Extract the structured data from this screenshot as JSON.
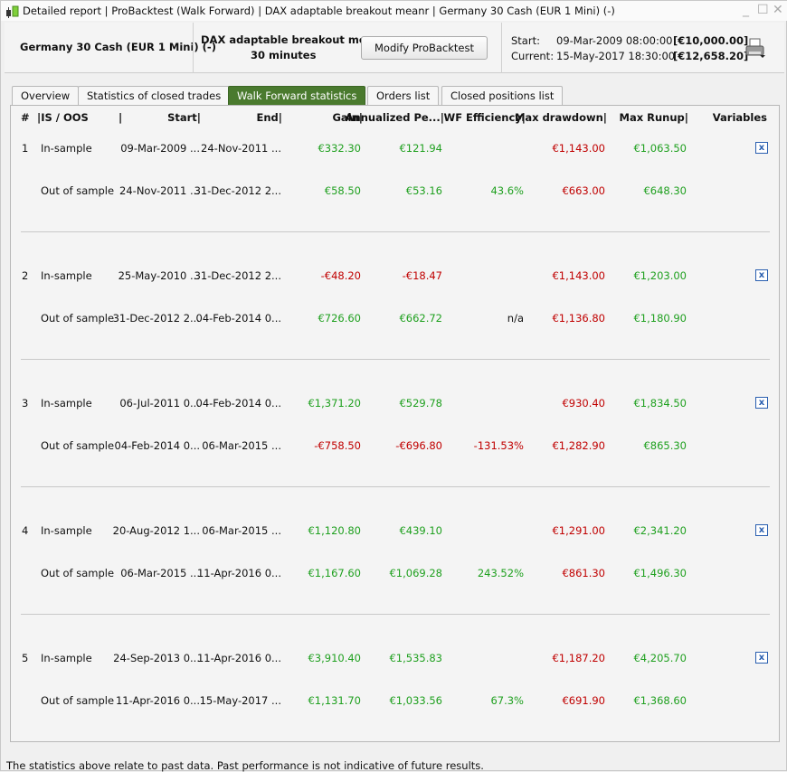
{
  "title": {
    "parts": "Detailed report | ProBacktest (Walk Forward) | DAX adaptable breakout meanr | Germany 30 Cash (EUR 1 Mini) (-)"
  },
  "header": {
    "instrument": "Germany 30 Cash (EUR 1 Mini) (-)",
    "strategy": "DAX adaptable breakout meanr",
    "timeframe": "30 minutes",
    "modify_label": "Modify ProBacktest",
    "start_label": "Start:",
    "start_value": "09-Mar-2009 08:00:00",
    "start_capital": "[€10,000.00]",
    "current_label": "Current:",
    "current_value": "15-May-2017 18:30:00",
    "current_capital": "[€12,658.20]"
  },
  "tabs": [
    "Overview",
    "Statistics of closed trades",
    "Walk Forward statistics",
    "Orders list",
    "Closed positions list"
  ],
  "columns": [
    "#",
    "|IS / OOS",
    "|",
    "Start|",
    "End|",
    "Gain|",
    "Annualized Pe...|",
    "WF Efficiency|",
    "Max drawdown|",
    "Max Runup|",
    "Variables"
  ],
  "groups": [
    {
      "n": "1",
      "rows": [
        {
          "type": "In-sample",
          "start": "09-Mar-2009 ...",
          "end": "24-Nov-2011 ...",
          "gain": "€332.30",
          "ann": "€121.94",
          "wf": "",
          "dd": "€1,143.00",
          "runup": "€1,063.50"
        },
        {
          "type": "Out of sample",
          "start": "24-Nov-2011 ...",
          "end": "31-Dec-2012 2...",
          "gain": "€58.50",
          "ann": "€53.16",
          "wf": "43.6%",
          "dd": "€663.00",
          "runup": "€648.30"
        }
      ]
    },
    {
      "n": "2",
      "rows": [
        {
          "type": "In-sample",
          "start": "25-May-2010 ...",
          "end": "31-Dec-2012 2...",
          "gain": "-€48.20",
          "ann": "-€18.47",
          "wf": "",
          "dd": "€1,143.00",
          "runup": "€1,203.00"
        },
        {
          "type": "Out of sample",
          "start": "31-Dec-2012 2...",
          "end": "04-Feb-2014 0...",
          "gain": "€726.60",
          "ann": "€662.72",
          "wf": "n/a",
          "dd": "€1,136.80",
          "runup": "€1,180.90"
        }
      ]
    },
    {
      "n": "3",
      "rows": [
        {
          "type": "In-sample",
          "start": "06-Jul-2011 0...",
          "end": "04-Feb-2014 0...",
          "gain": "€1,371.20",
          "ann": "€529.78",
          "wf": "",
          "dd": "€930.40",
          "runup": "€1,834.50"
        },
        {
          "type": "Out of sample",
          "start": "04-Feb-2014 0...",
          "end": "06-Mar-2015 ...",
          "gain": "-€758.50",
          "ann": "-€696.80",
          "wf": "-131.53%",
          "dd": "€1,282.90",
          "runup": "€865.30"
        }
      ]
    },
    {
      "n": "4",
      "rows": [
        {
          "type": "In-sample",
          "start": "20-Aug-2012 1...",
          "end": "06-Mar-2015 ...",
          "gain": "€1,120.80",
          "ann": "€439.10",
          "wf": "",
          "dd": "€1,291.00",
          "runup": "€2,341.20"
        },
        {
          "type": "Out of sample",
          "start": "06-Mar-2015 ...",
          "end": "11-Apr-2016 0...",
          "gain": "€1,167.60",
          "ann": "€1,069.28",
          "wf": "243.52%",
          "dd": "€861.30",
          "runup": "€1,496.30"
        }
      ]
    },
    {
      "n": "5",
      "rows": [
        {
          "type": "In-sample",
          "start": "24-Sep-2013 0...",
          "end": "11-Apr-2016 0...",
          "gain": "€3,910.40",
          "ann": "€1,535.83",
          "wf": "",
          "dd": "€1,187.20",
          "runup": "€4,205.70"
        },
        {
          "type": "Out of sample",
          "start": "11-Apr-2016 0...",
          "end": "15-May-2017 ...",
          "gain": "€1,131.70",
          "ann": "€1,033.56",
          "wf": "67.3%",
          "dd": "€691.90",
          "runup": "€1,368.60"
        }
      ]
    }
  ],
  "footer": "The statistics above relate to past data. Past performance is not indicative of future results.",
  "colors": {
    "positive": "#1fa01f",
    "negative": "#c00000",
    "accent": "#4a7a2e"
  }
}
